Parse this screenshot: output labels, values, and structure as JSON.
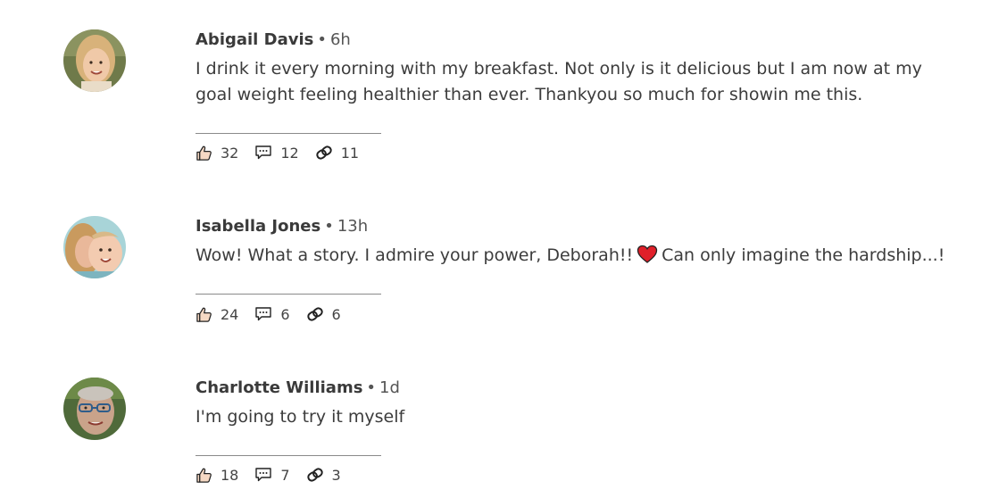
{
  "comments": [
    {
      "author": "Abigail Davis",
      "time": "6h",
      "text": "I drink it every morning with my breakfast. Not only is it delicious but I am now at my goal weight feeling healthier than ever. Thankyou so much for showin me this.",
      "likes": "32",
      "replies": "12",
      "shares": "11"
    },
    {
      "author": "Isabella Jones",
      "time": "13h",
      "text_before": "Wow! What a story. I admire your power, Deborah!!",
      "emoji": "heart-emoji",
      "text_after": "Can only imagine the hardship...!",
      "likes": "24",
      "replies": "6",
      "shares": "6"
    },
    {
      "author": "Charlotte Williams",
      "time": "1d",
      "text": "I'm going to try it myself",
      "likes": "18",
      "replies": "7",
      "shares": "3"
    }
  ],
  "separator": "•",
  "icons": {
    "like": "thumbs-up-icon",
    "reply": "speech-bubble-icon",
    "share": "link-icon"
  },
  "colors": {
    "heart": "#e0202a",
    "thumb_fill": "#f6d9c4"
  }
}
